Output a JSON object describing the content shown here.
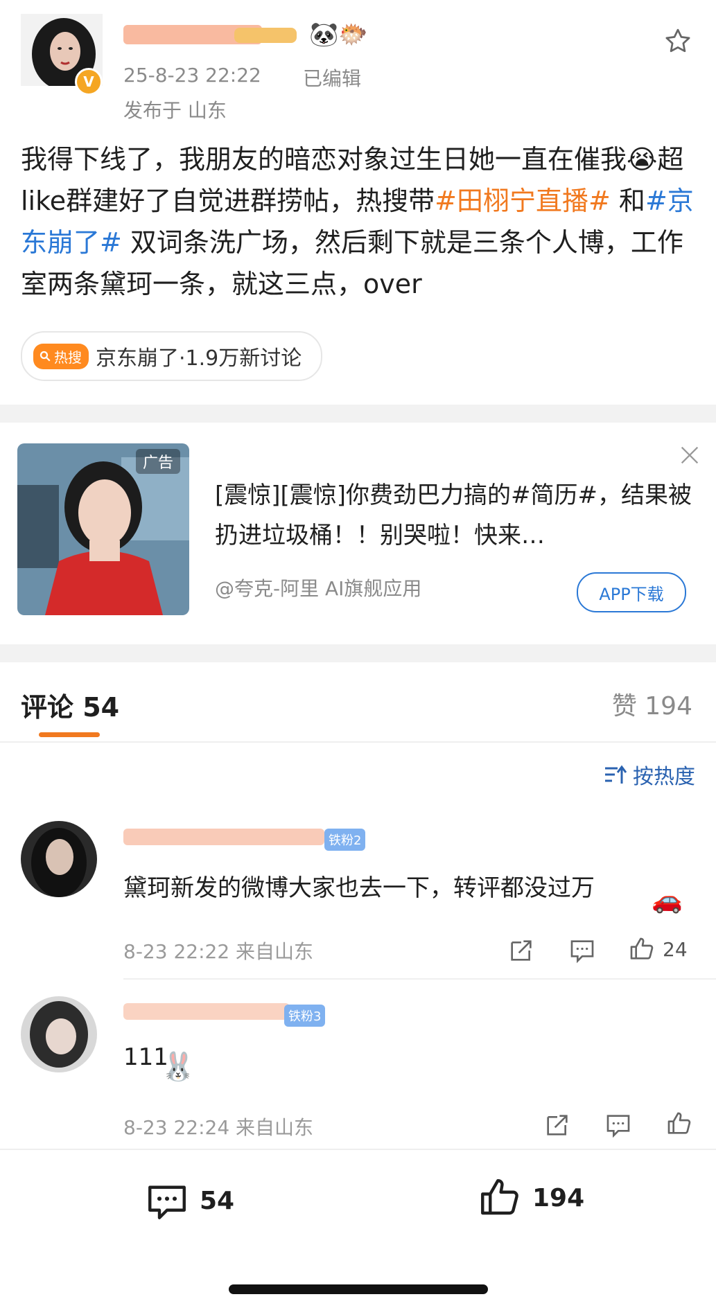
{
  "post": {
    "timestamp": "25-8-23 22:22",
    "edited_label": "已编辑",
    "location": "发布于 山东",
    "text_part1": "我得下线了，我朋友的暗恋对象过生日她一直在催我",
    "text_emoji": "😭",
    "text_part2": "超like群建好了自觉进群捞帖，热搜带",
    "tag1": "#田栩宁直播#",
    "text_part3": " 和",
    "tag2": "#京东崩了#",
    "text_part4": " 双词条洗广场，然后剩下就是三条个人博，工作室两条黛珂一条，就这三点，over",
    "hot_badge": "热搜",
    "hot_topic": "京东崩了·1.9万新讨论"
  },
  "ad": {
    "tag": "广告",
    "text": "[震惊][震惊]你费劲巴力搞的#简历#，结果被扔进垃圾桶！！别哭啦！快来…",
    "source": "@夸克-阿里 AI旗舰应用",
    "button": "APP下载"
  },
  "comments_section": {
    "tab_label": "评论 54",
    "likes_label": "赞 194",
    "sort_label": "按热度"
  },
  "comments": [
    {
      "fan_badge": "铁粉2",
      "text": "黛珂新发的微博大家也去一下，转评都没过万",
      "time": "8-23 22:22",
      "from": "来自山东",
      "likes": "24"
    },
    {
      "fan_badge": "铁粉3",
      "text": "111",
      "time": "8-23 22:24",
      "from": "来自山东",
      "likes": ""
    }
  ],
  "footer": {
    "comment_count": "54",
    "like_count": "194"
  },
  "colors": {
    "accent_orange": "#f1791f",
    "link_blue": "#2a78d6",
    "verified": "#f5a623"
  }
}
